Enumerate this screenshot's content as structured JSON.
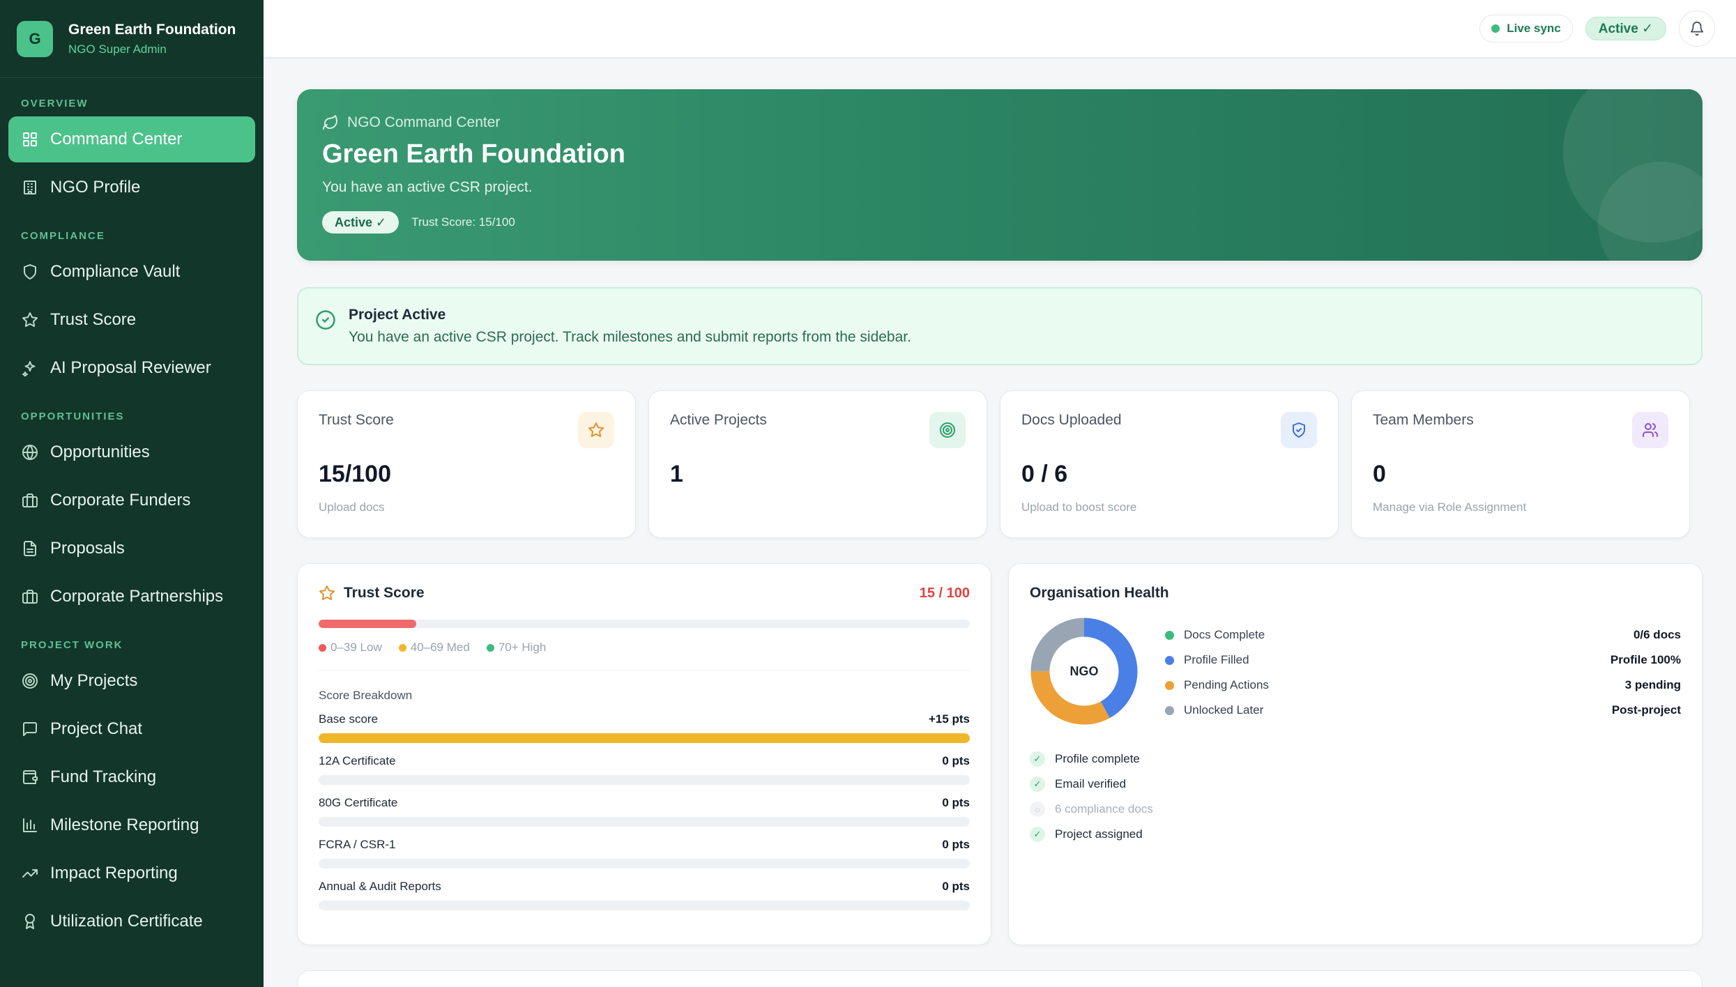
{
  "brand": {
    "logo_letter": "G",
    "name": "Green Earth Foundation",
    "role": "NGO Super Admin"
  },
  "sidebar": {
    "sections": [
      {
        "title": "OVERVIEW",
        "items": [
          {
            "label": "Command Center",
            "icon": "grid-icon",
            "active": true
          },
          {
            "label": "NGO Profile",
            "icon": "building-icon"
          }
        ]
      },
      {
        "title": "COMPLIANCE",
        "items": [
          {
            "label": "Compliance Vault",
            "icon": "shield-icon"
          },
          {
            "label": "Trust Score",
            "icon": "star-icon"
          },
          {
            "label": "AI Proposal Reviewer",
            "icon": "sparkle-icon"
          }
        ]
      },
      {
        "title": "OPPORTUNITIES",
        "items": [
          {
            "label": "Opportunities",
            "icon": "globe-icon"
          },
          {
            "label": "Corporate Funders",
            "icon": "briefcase-icon"
          },
          {
            "label": "Proposals",
            "icon": "document-icon"
          },
          {
            "label": "Corporate Partnerships",
            "icon": "briefcase-icon"
          }
        ]
      },
      {
        "title": "PROJECT WORK",
        "items": [
          {
            "label": "My Projects",
            "icon": "target-icon"
          },
          {
            "label": "Project Chat",
            "icon": "chat-icon"
          },
          {
            "label": "Fund Tracking",
            "icon": "wallet-icon"
          },
          {
            "label": "Milestone Reporting",
            "icon": "bar-chart-icon"
          },
          {
            "label": "Impact Reporting",
            "icon": "trend-up-icon"
          },
          {
            "label": "Utilization Certificate",
            "icon": "award-icon"
          }
        ]
      }
    ]
  },
  "topbar": {
    "live_sync": "Live sync",
    "status": "Active ✓"
  },
  "hero": {
    "kicker": "NGO Command Center",
    "title": "Green Earth Foundation",
    "subtitle": "You have an active CSR project.",
    "badge": "Active ✓",
    "trust_text": "Trust Score: 15/100"
  },
  "alert": {
    "title": "Project Active",
    "text": "You have an active CSR project. Track milestones and submit reports from the sidebar."
  },
  "stats": [
    {
      "label": "Trust Score",
      "value": "15/100",
      "hint": "Upload docs",
      "icon": "star-icon",
      "icon_color": "#e0942e",
      "icon_bg": "#fdf3e2"
    },
    {
      "label": "Active Projects",
      "value": "1",
      "hint": "",
      "icon": "target-icon",
      "icon_color": "#2f9e6b",
      "icon_bg": "#e3f5ec"
    },
    {
      "label": "Docs Uploaded",
      "value": "0 / 6",
      "hint": "Upload to boost score",
      "icon": "shield-check-icon",
      "icon_color": "#3b6fd8",
      "icon_bg": "#e7eefc"
    },
    {
      "label": "Team Members",
      "value": "0",
      "hint": "Manage via Role Assignment",
      "icon": "users-icon",
      "icon_color": "#8b4fd6",
      "icon_bg": "#f1e9fc"
    }
  ],
  "trust_card": {
    "title": "Trust Score",
    "score": "15 / 100",
    "progress": 0.15,
    "legend": [
      {
        "label": "0–39 Low",
        "color": "#ef5b5b"
      },
      {
        "label": "40–69 Med",
        "color": "#f0b62a"
      },
      {
        "label": "70+ High",
        "color": "#3dbb7f"
      }
    ],
    "breakdown_label": "Score Breakdown",
    "rows": [
      {
        "name": "Base score",
        "pts": "+15 pts",
        "fill": 1.0
      },
      {
        "name": "12A Certificate",
        "pts": "0 pts",
        "fill": 0
      },
      {
        "name": "80G Certificate",
        "pts": "0 pts",
        "fill": 0
      },
      {
        "name": "FCRA / CSR-1",
        "pts": "0 pts",
        "fill": 0
      },
      {
        "name": "Annual & Audit Reports",
        "pts": "0 pts",
        "fill": 0
      }
    ]
  },
  "health": {
    "title": "Organisation Health",
    "center_label": "NGO",
    "segments": [
      {
        "label": "Docs Complete",
        "value": "0/6 docs",
        "color": "#3dbb7f",
        "share": 0
      },
      {
        "label": "Profile Filled",
        "value": "Profile 100%",
        "color": "#4a7fe5",
        "share": 0.42
      },
      {
        "label": "Pending Actions",
        "value": "3 pending",
        "color": "#eda038",
        "share": 0.33
      },
      {
        "label": "Unlocked Later",
        "value": "Post-project",
        "color": "#99a5b3",
        "share": 0.25
      }
    ],
    "checks": [
      {
        "label": "Profile complete",
        "done": true
      },
      {
        "label": "Email verified",
        "done": true
      },
      {
        "label": "6 compliance docs",
        "done": false
      },
      {
        "label": "Project assigned",
        "done": true
      }
    ]
  }
}
